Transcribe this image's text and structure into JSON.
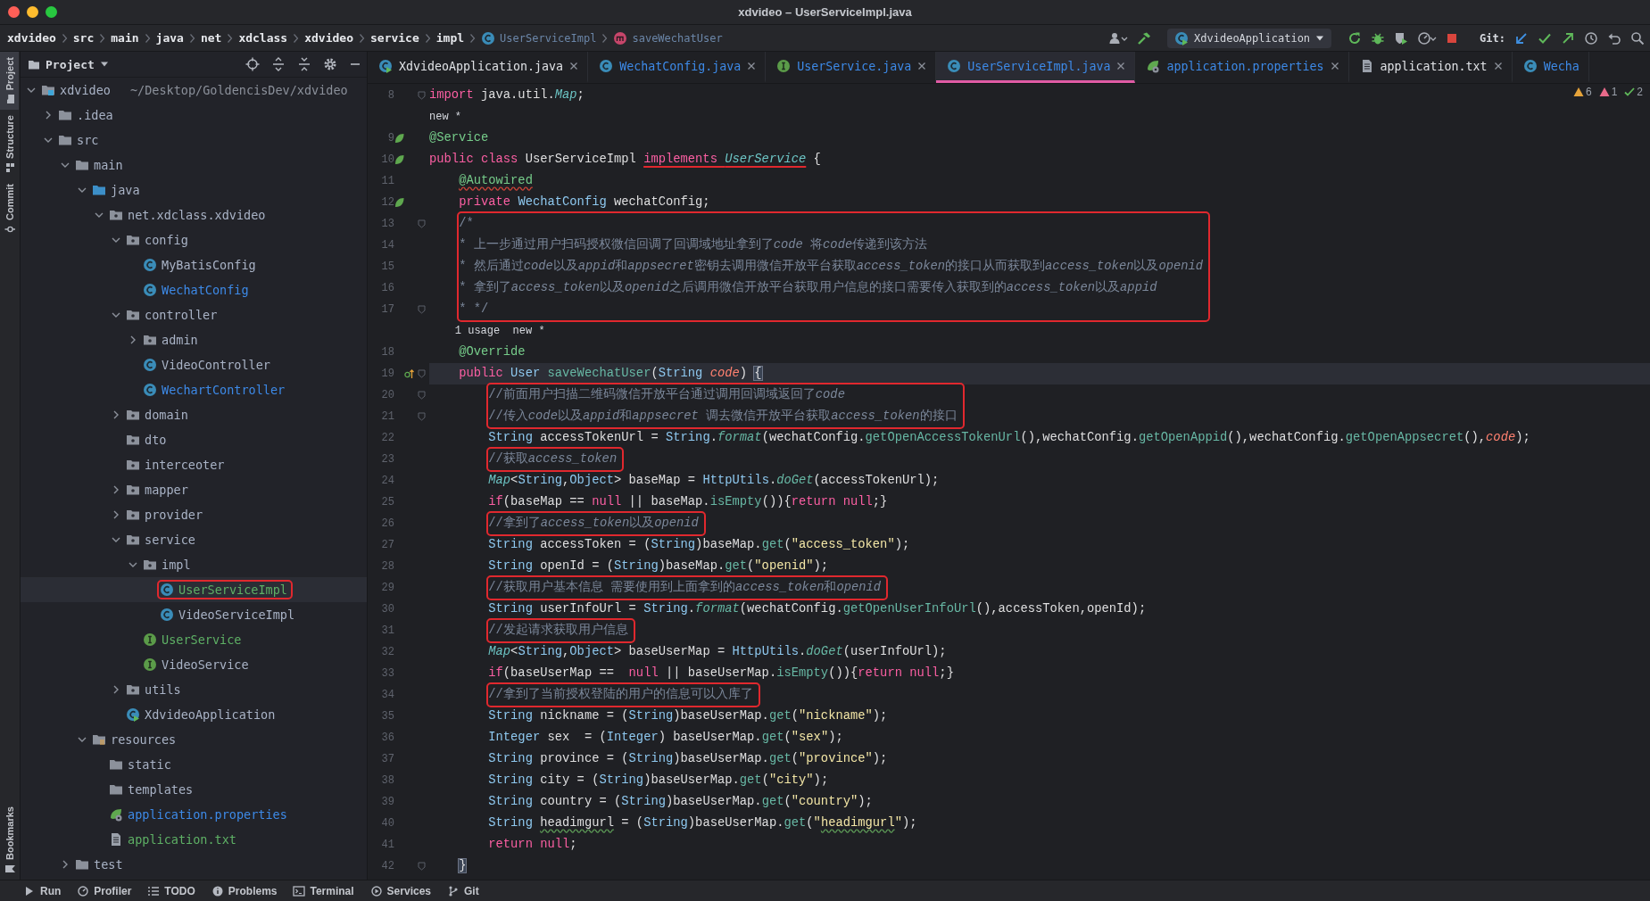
{
  "window": {
    "title": "xdvideo – UserServiceImpl.java"
  },
  "breadcrumb": [
    {
      "text": "xdvideo",
      "kind": "folder"
    },
    {
      "text": "src",
      "kind": "folder"
    },
    {
      "text": "main",
      "kind": "folder"
    },
    {
      "text": "java",
      "kind": "folder"
    },
    {
      "text": "net",
      "kind": "folder"
    },
    {
      "text": "xdclass",
      "kind": "folder"
    },
    {
      "text": "xdvideo",
      "kind": "folder"
    },
    {
      "text": "service",
      "kind": "folder"
    },
    {
      "text": "impl",
      "kind": "folder"
    },
    {
      "text": "UserServiceImpl",
      "kind": "class"
    },
    {
      "text": "saveWechatUser",
      "kind": "method"
    }
  ],
  "toolbar": {
    "run_config": "XdvideoApplication",
    "git_label": "Git:"
  },
  "tool_strip": {
    "top": [
      {
        "label": "Project",
        "kind": "project",
        "selected": true
      },
      {
        "label": "Structure",
        "kind": "structure",
        "selected": false
      },
      {
        "label": "Commit",
        "kind": "commit",
        "selected": false
      }
    ],
    "bottom": [
      {
        "label": "Bookmarks",
        "kind": "bookmarks",
        "selected": false
      }
    ]
  },
  "project_panel": {
    "title": "Project",
    "tree": [
      {
        "label": "xdvideo",
        "path": "~/Desktop/GoldencisDev/xdvideo",
        "kind": "module",
        "color": "#a9b3c6",
        "expanded": true,
        "selected": false,
        "boxed": false,
        "children": [
          {
            "label": ".idea",
            "kind": "folder",
            "color": "#a9b3c6",
            "expanded": false,
            "selected": false,
            "boxed": false
          },
          {
            "label": "src",
            "kind": "folder",
            "color": "#a9b3c6",
            "expanded": true,
            "selected": false,
            "boxed": false,
            "children": [
              {
                "label": "main",
                "kind": "folder",
                "color": "#a9b3c6",
                "expanded": true,
                "selected": false,
                "boxed": false,
                "children": [
                  {
                    "label": "java",
                    "kind": "source-folder",
                    "color": "#a9b3c6",
                    "expanded": true,
                    "selected": false,
                    "boxed": false,
                    "children": [
                      {
                        "label": "net.xdclass.xdvideo",
                        "kind": "package",
                        "color": "#a9b3c6",
                        "expanded": true,
                        "selected": false,
                        "boxed": false,
                        "children": [
                          {
                            "label": "config",
                            "kind": "package",
                            "color": "#a9b3c6",
                            "expanded": true,
                            "selected": false,
                            "boxed": false,
                            "children": [
                              {
                                "label": "MyBatisConfig",
                                "kind": "class",
                                "color": "#a9b3c6",
                                "selected": false,
                                "boxed": false
                              },
                              {
                                "label": "WechatConfig",
                                "kind": "class",
                                "color": "#3d8ae8",
                                "selected": false,
                                "boxed": false
                              }
                            ]
                          },
                          {
                            "label": "controller",
                            "kind": "package",
                            "color": "#a9b3c6",
                            "expanded": true,
                            "selected": false,
                            "boxed": false,
                            "children": [
                              {
                                "label": "admin",
                                "kind": "package",
                                "color": "#a9b3c6",
                                "expanded": false,
                                "selected": false,
                                "boxed": false
                              },
                              {
                                "label": "VideoController",
                                "kind": "class",
                                "color": "#a9b3c6",
                                "selected": false,
                                "boxed": false
                              },
                              {
                                "label": "WechartController",
                                "kind": "class",
                                "color": "#3d8ae8",
                                "selected": false,
                                "boxed": false
                              }
                            ]
                          },
                          {
                            "label": "domain",
                            "kind": "package",
                            "color": "#a9b3c6",
                            "expanded": false,
                            "selected": false,
                            "boxed": false
                          },
                          {
                            "label": "dto",
                            "kind": "package",
                            "color": "#a9b3c6",
                            "selected": false,
                            "boxed": false
                          },
                          {
                            "label": "interceoter",
                            "kind": "package",
                            "color": "#a9b3c6",
                            "selected": false,
                            "boxed": false
                          },
                          {
                            "label": "mapper",
                            "kind": "package",
                            "color": "#a9b3c6",
                            "expanded": false,
                            "selected": false,
                            "boxed": false
                          },
                          {
                            "label": "provider",
                            "kind": "package",
                            "color": "#a9b3c6",
                            "expanded": false,
                            "selected": false,
                            "boxed": false
                          },
                          {
                            "label": "service",
                            "kind": "package",
                            "color": "#a9b3c6",
                            "expanded": true,
                            "selected": false,
                            "boxed": false,
                            "children": [
                              {
                                "label": "impl",
                                "kind": "package",
                                "color": "#a9b3c6",
                                "expanded": true,
                                "selected": false,
                                "boxed": false,
                                "children": [
                                  {
                                    "label": "UserServiceImpl",
                                    "kind": "class",
                                    "color": "#5eb065",
                                    "selected": true,
                                    "boxed": true
                                  },
                                  {
                                    "label": "VideoServiceImpl",
                                    "kind": "class",
                                    "color": "#a9b3c6",
                                    "selected": false,
                                    "boxed": false
                                  }
                                ]
                              },
                              {
                                "label": "UserService",
                                "kind": "interface",
                                "color": "#5eb065",
                                "selected": false,
                                "boxed": false
                              },
                              {
                                "label": "VideoService",
                                "kind": "interface",
                                "color": "#a9b3c6",
                                "selected": false,
                                "boxed": false
                              }
                            ]
                          },
                          {
                            "label": "utils",
                            "kind": "package",
                            "color": "#a9b3c6",
                            "expanded": false,
                            "selected": false,
                            "boxed": false
                          },
                          {
                            "label": "XdvideoApplication",
                            "kind": "app",
                            "color": "#a9b3c6",
                            "selected": false,
                            "boxed": false
                          }
                        ]
                      }
                    ]
                  },
                  {
                    "label": "resources",
                    "kind": "resource-folder",
                    "color": "#a9b3c6",
                    "expanded": true,
                    "selected": false,
                    "boxed": false,
                    "children": [
                      {
                        "label": "static",
                        "kind": "folder",
                        "color": "#a9b3c6",
                        "selected": false,
                        "boxed": false
                      },
                      {
                        "label": "templates",
                        "kind": "folder",
                        "color": "#a9b3c6",
                        "selected": false,
                        "boxed": false
                      },
                      {
                        "label": "application.properties",
                        "kind": "properties",
                        "color": "#3d8ae8",
                        "selected": false,
                        "boxed": false
                      },
                      {
                        "label": "application.txt",
                        "kind": "text",
                        "color": "#5eb065",
                        "selected": false,
                        "boxed": false
                      }
                    ]
                  }
                ]
              },
              {
                "label": "test",
                "kind": "folder",
                "color": "#a9b3c6",
                "expanded": false,
                "selected": false,
                "boxed": false
              }
            ]
          }
        ]
      }
    ]
  },
  "tabs": [
    {
      "label": "XdvideoApplication.java",
      "kind": "app",
      "color": "#dfe1e5",
      "selected": false,
      "closable": true
    },
    {
      "label": "WechatConfig.java",
      "kind": "class",
      "color": "#3d8ae8",
      "selected": false,
      "closable": true
    },
    {
      "label": "UserService.java",
      "kind": "interface",
      "color": "#3d8ae8",
      "selected": false,
      "closable": true
    },
    {
      "label": "UserServiceImpl.java",
      "kind": "class",
      "color": "#3d8ae8",
      "selected": true,
      "closable": true
    },
    {
      "label": "application.properties",
      "kind": "properties",
      "color": "#3d8ae8",
      "selected": false,
      "closable": true
    },
    {
      "label": "application.txt",
      "kind": "text",
      "color": "#dfe1e5",
      "selected": false,
      "closable": true
    },
    {
      "label": "Wecha",
      "kind": "class",
      "color": "#3d8ae8",
      "selected": false,
      "closable": false
    }
  ],
  "inspections": [
    {
      "kind": "warning",
      "count": "6"
    },
    {
      "kind": "weak",
      "count": "1"
    },
    {
      "kind": "ok",
      "count": "2"
    }
  ],
  "editor": {
    "rows": [
      {
        "kind": "code",
        "number": "8",
        "spring_bean": false,
        "overrides": false,
        "fold": true,
        "boxed": false,
        "current": false,
        "tokens": [
          {
            "kind": "keyword",
            "text": "import "
          },
          {
            "kind": "plain",
            "text": "java.util."
          },
          {
            "kind": "type-italic",
            "text": "Map"
          },
          {
            "kind": "plain",
            "text": ";"
          }
        ]
      },
      {
        "kind": "hint",
        "text": "new *"
      },
      {
        "kind": "code",
        "number": "9",
        "spring_bean": true,
        "overrides": false,
        "fold": false,
        "boxed": false,
        "current": false,
        "tokens": [
          {
            "kind": "annotation",
            "text": "@Service"
          }
        ]
      },
      {
        "kind": "code",
        "number": "10",
        "spring_bean": true,
        "overrides": false,
        "fold": false,
        "boxed": false,
        "current": false,
        "tokens": [
          {
            "kind": "keyword",
            "text": "public class "
          },
          {
            "kind": "plain",
            "text": "UserServiceImpl "
          },
          {
            "kind": "keyword",
            "text": "implements ",
            "marked": true
          },
          {
            "kind": "type-italic",
            "text": "UserService",
            "marked": true
          },
          {
            "kind": "plain",
            "text": " {"
          }
        ]
      },
      {
        "kind": "code",
        "number": "11",
        "spring_bean": false,
        "overrides": false,
        "fold": false,
        "boxed": false,
        "current": false,
        "tokens": [
          {
            "kind": "annotation",
            "text": "    @Autowired",
            "error": true
          }
        ]
      },
      {
        "kind": "code",
        "number": "12",
        "spring_bean": true,
        "overrides": false,
        "fold": false,
        "boxed": false,
        "current": false,
        "tokens": [
          {
            "kind": "keyword",
            "text": "    private "
          },
          {
            "kind": "type",
            "text": "WechatConfig "
          },
          {
            "kind": "plain",
            "text": "wechatConfig;"
          }
        ]
      },
      {
        "kind": "code",
        "number": "13",
        "spring_bean": false,
        "overrides": false,
        "fold": true,
        "boxed": true,
        "current": false,
        "tokens": [
          {
            "kind": "comment",
            "text": "    /*"
          }
        ]
      },
      {
        "kind": "code",
        "number": "14",
        "spring_bean": false,
        "overrides": false,
        "fold": false,
        "boxed": true,
        "current": false,
        "tokens": [
          {
            "kind": "comment",
            "text": "    * 上一步通过用户扫码授权微信回调了回调域地址拿到了"
          },
          {
            "kind": "comment-italic",
            "text": "code"
          },
          {
            "kind": "comment",
            "text": " 将"
          },
          {
            "kind": "comment-italic",
            "text": "code"
          },
          {
            "kind": "comment",
            "text": "传递到该方法"
          }
        ]
      },
      {
        "kind": "code",
        "number": "15",
        "spring_bean": false,
        "overrides": false,
        "fold": false,
        "boxed": true,
        "current": false,
        "tokens": [
          {
            "kind": "comment",
            "text": "    * 然后通过"
          },
          {
            "kind": "comment-italic",
            "text": "code"
          },
          {
            "kind": "comment",
            "text": "以及"
          },
          {
            "kind": "comment-italic",
            "text": "appid"
          },
          {
            "kind": "comment",
            "text": "和"
          },
          {
            "kind": "comment-italic",
            "text": "appsecret"
          },
          {
            "kind": "comment",
            "text": "密钥去调用微信开放平台获取"
          },
          {
            "kind": "comment-italic",
            "text": "access_token"
          },
          {
            "kind": "comment",
            "text": "的接口从而获取到"
          },
          {
            "kind": "comment-italic",
            "text": "access_token"
          },
          {
            "kind": "comment",
            "text": "以及"
          },
          {
            "kind": "comment-italic",
            "text": "openid"
          }
        ]
      },
      {
        "kind": "code",
        "number": "16",
        "spring_bean": false,
        "overrides": false,
        "fold": false,
        "boxed": true,
        "current": false,
        "tokens": [
          {
            "kind": "comment",
            "text": "    * 拿到了"
          },
          {
            "kind": "comment-italic",
            "text": "access_token"
          },
          {
            "kind": "comment",
            "text": "以及"
          },
          {
            "kind": "comment-italic",
            "text": "openid"
          },
          {
            "kind": "comment",
            "text": "之后调用微信开放平台获取用户信息的接口需要传入获取到的"
          },
          {
            "kind": "comment-italic",
            "text": "access_token"
          },
          {
            "kind": "comment",
            "text": "以及"
          },
          {
            "kind": "comment-italic",
            "text": "appid"
          }
        ]
      },
      {
        "kind": "code",
        "number": "17",
        "spring_bean": false,
        "overrides": false,
        "fold": true,
        "boxed": true,
        "current": false,
        "tokens": [
          {
            "kind": "comment",
            "text": "    * */"
          }
        ]
      },
      {
        "kind": "hint",
        "text": "    1 usage  new *"
      },
      {
        "kind": "code",
        "number": "18",
        "spring_bean": false,
        "overrides": false,
        "fold": false,
        "boxed": false,
        "current": false,
        "tokens": [
          {
            "kind": "annotation",
            "text": "    @Override"
          }
        ]
      },
      {
        "kind": "code",
        "number": "19",
        "spring_bean": false,
        "overrides": true,
        "fold": true,
        "boxed": false,
        "current": true,
        "tokens": [
          {
            "kind": "keyword",
            "text": "    public "
          },
          {
            "kind": "type",
            "text": "User "
          },
          {
            "kind": "method",
            "text": "saveWechatUser"
          },
          {
            "kind": "plain",
            "text": "("
          },
          {
            "kind": "type",
            "text": "String "
          },
          {
            "kind": "parameter",
            "text": "code"
          },
          {
            "kind": "plain",
            "text": ") "
          },
          {
            "kind": "plain",
            "text": "{",
            "matched": true
          }
        ]
      },
      {
        "kind": "code",
        "number": "20",
        "spring_bean": false,
        "overrides": false,
        "fold": true,
        "boxed": true,
        "current": false,
        "tokens": [
          {
            "kind": "comment",
            "text": "        //前面用户扫描二维码微信开放平台通过调用回调域返回了"
          },
          {
            "kind": "comment-italic",
            "text": "code"
          }
        ]
      },
      {
        "kind": "code",
        "number": "21",
        "spring_bean": false,
        "overrides": false,
        "fold": true,
        "boxed": true,
        "current": false,
        "tokens": [
          {
            "kind": "comment",
            "text": "        //传入"
          },
          {
            "kind": "comment-italic",
            "text": "code"
          },
          {
            "kind": "comment",
            "text": "以及"
          },
          {
            "kind": "comment-italic",
            "text": "appid"
          },
          {
            "kind": "comment",
            "text": "和"
          },
          {
            "kind": "comment-italic",
            "text": "appsecret"
          },
          {
            "kind": "comment",
            "text": " 调去微信开放平台获取"
          },
          {
            "kind": "comment-italic",
            "text": "access_token"
          },
          {
            "kind": "comment",
            "text": "的接口"
          }
        ]
      },
      {
        "kind": "code",
        "number": "22",
        "spring_bean": false,
        "overrides": false,
        "fold": false,
        "boxed": false,
        "current": false,
        "tokens": [
          {
            "kind": "type",
            "text": "        String "
          },
          {
            "kind": "plain",
            "text": "accessTokenUrl = "
          },
          {
            "kind": "type",
            "text": "String"
          },
          {
            "kind": "plain",
            "text": "."
          },
          {
            "kind": "static-method",
            "text": "format"
          },
          {
            "kind": "plain",
            "text": "(wechatConfig."
          },
          {
            "kind": "method",
            "text": "getOpenAccessTokenUrl"
          },
          {
            "kind": "plain",
            "text": "(),wechatConfig."
          },
          {
            "kind": "method",
            "text": "getOpenAppid"
          },
          {
            "kind": "plain",
            "text": "(),wechatConfig."
          },
          {
            "kind": "method",
            "text": "getOpenAppsecret"
          },
          {
            "kind": "plain",
            "text": "(),"
          },
          {
            "kind": "parameter",
            "text": "code"
          },
          {
            "kind": "plain",
            "text": ");"
          }
        ]
      },
      {
        "kind": "code",
        "number": "23",
        "spring_bean": false,
        "overrides": false,
        "fold": false,
        "boxed": true,
        "current": false,
        "tokens": [
          {
            "kind": "comment",
            "text": "        //获取"
          },
          {
            "kind": "comment-italic",
            "text": "access_token"
          }
        ]
      },
      {
        "kind": "code",
        "number": "24",
        "spring_bean": false,
        "overrides": false,
        "fold": false,
        "boxed": false,
        "current": false,
        "tokens": [
          {
            "kind": "type-italic",
            "text": "        Map"
          },
          {
            "kind": "plain",
            "text": "<"
          },
          {
            "kind": "type",
            "text": "String"
          },
          {
            "kind": "plain",
            "text": ","
          },
          {
            "kind": "type",
            "text": "Object"
          },
          {
            "kind": "plain",
            "text": "> baseMap = "
          },
          {
            "kind": "type",
            "text": "HttpUtils"
          },
          {
            "kind": "plain",
            "text": "."
          },
          {
            "kind": "static-method",
            "text": "doGet"
          },
          {
            "kind": "plain",
            "text": "(accessTokenUrl);"
          }
        ]
      },
      {
        "kind": "code",
        "number": "25",
        "spring_bean": false,
        "overrides": false,
        "fold": false,
        "boxed": false,
        "current": false,
        "tokens": [
          {
            "kind": "keyword",
            "text": "        if"
          },
          {
            "kind": "plain",
            "text": "(baseMap == "
          },
          {
            "kind": "keyword",
            "text": "null"
          },
          {
            "kind": "plain",
            "text": " || baseMap."
          },
          {
            "kind": "method",
            "text": "isEmpty"
          },
          {
            "kind": "plain",
            "text": "()){"
          },
          {
            "kind": "keyword",
            "text": "return null"
          },
          {
            "kind": "plain",
            "text": ";}"
          }
        ]
      },
      {
        "kind": "code",
        "number": "26",
        "spring_bean": false,
        "overrides": false,
        "fold": false,
        "boxed": true,
        "current": false,
        "tokens": [
          {
            "kind": "comment",
            "text": "        //拿到了"
          },
          {
            "kind": "comment-italic",
            "text": "access_token"
          },
          {
            "kind": "comment",
            "text": "以及"
          },
          {
            "kind": "comment-italic",
            "text": "openid"
          }
        ]
      },
      {
        "kind": "code",
        "number": "27",
        "spring_bean": false,
        "overrides": false,
        "fold": false,
        "boxed": false,
        "current": false,
        "tokens": [
          {
            "kind": "type",
            "text": "        String "
          },
          {
            "kind": "plain",
            "text": "accessToken = ("
          },
          {
            "kind": "type",
            "text": "String"
          },
          {
            "kind": "plain",
            "text": ")baseMap."
          },
          {
            "kind": "method",
            "text": "get"
          },
          {
            "kind": "plain",
            "text": "("
          },
          {
            "kind": "string",
            "text": "\"access_token\""
          },
          {
            "kind": "plain",
            "text": ");"
          }
        ]
      },
      {
        "kind": "code",
        "number": "28",
        "spring_bean": false,
        "overrides": false,
        "fold": false,
        "boxed": false,
        "current": false,
        "tokens": [
          {
            "kind": "type",
            "text": "        String "
          },
          {
            "kind": "plain",
            "text": "openId = ("
          },
          {
            "kind": "type",
            "text": "String"
          },
          {
            "kind": "plain",
            "text": ")baseMap."
          },
          {
            "kind": "method",
            "text": "get"
          },
          {
            "kind": "plain",
            "text": "("
          },
          {
            "kind": "string",
            "text": "\"openid\""
          },
          {
            "kind": "plain",
            "text": ");"
          }
        ]
      },
      {
        "kind": "code",
        "number": "29",
        "spring_bean": false,
        "overrides": false,
        "fold": false,
        "boxed": true,
        "current": false,
        "tokens": [
          {
            "kind": "comment",
            "text": "        //获取用户基本信息 需要使用到上面拿到的"
          },
          {
            "kind": "comment-italic",
            "text": "access_token"
          },
          {
            "kind": "comment",
            "text": "和"
          },
          {
            "kind": "comment-italic",
            "text": "openid"
          }
        ]
      },
      {
        "kind": "code",
        "number": "30",
        "spring_bean": false,
        "overrides": false,
        "fold": false,
        "boxed": false,
        "current": false,
        "tokens": [
          {
            "kind": "type",
            "text": "        String "
          },
          {
            "kind": "plain",
            "text": "userInfoUrl = "
          },
          {
            "kind": "type",
            "text": "String"
          },
          {
            "kind": "plain",
            "text": "."
          },
          {
            "kind": "static-method",
            "text": "format"
          },
          {
            "kind": "plain",
            "text": "(wechatConfig."
          },
          {
            "kind": "method",
            "text": "getOpenUserInfoUrl"
          },
          {
            "kind": "plain",
            "text": "(),accessToken,openId);"
          }
        ]
      },
      {
        "kind": "code",
        "number": "31",
        "spring_bean": false,
        "overrides": false,
        "fold": false,
        "boxed": true,
        "current": false,
        "tokens": [
          {
            "kind": "comment",
            "text": "        //发起请求获取用户信息"
          }
        ]
      },
      {
        "kind": "code",
        "number": "32",
        "spring_bean": false,
        "overrides": false,
        "fold": false,
        "boxed": false,
        "current": false,
        "tokens": [
          {
            "kind": "type-italic",
            "text": "        Map"
          },
          {
            "kind": "plain",
            "text": "<"
          },
          {
            "kind": "type",
            "text": "String"
          },
          {
            "kind": "plain",
            "text": ","
          },
          {
            "kind": "type",
            "text": "Object"
          },
          {
            "kind": "plain",
            "text": "> baseUserMap = "
          },
          {
            "kind": "type",
            "text": "HttpUtils"
          },
          {
            "kind": "plain",
            "text": "."
          },
          {
            "kind": "static-method",
            "text": "doGet"
          },
          {
            "kind": "plain",
            "text": "(userInfoUrl);"
          }
        ]
      },
      {
        "kind": "code",
        "number": "33",
        "spring_bean": false,
        "overrides": false,
        "fold": false,
        "boxed": false,
        "current": false,
        "tokens": [
          {
            "kind": "keyword",
            "text": "        if"
          },
          {
            "kind": "plain",
            "text": "(baseUserMap ==  "
          },
          {
            "kind": "keyword",
            "text": "null"
          },
          {
            "kind": "plain",
            "text": " || baseUserMap."
          },
          {
            "kind": "method",
            "text": "isEmpty"
          },
          {
            "kind": "plain",
            "text": "()){"
          },
          {
            "kind": "keyword",
            "text": "return null"
          },
          {
            "kind": "plain",
            "text": ";}"
          }
        ]
      },
      {
        "kind": "code",
        "number": "34",
        "spring_bean": false,
        "overrides": false,
        "fold": false,
        "boxed": true,
        "current": false,
        "tokens": [
          {
            "kind": "comment",
            "text": "        //拿到了当前授权登陆的用户的信息可以入库了"
          }
        ]
      },
      {
        "kind": "code",
        "number": "35",
        "spring_bean": false,
        "overrides": false,
        "fold": false,
        "boxed": false,
        "current": false,
        "tokens": [
          {
            "kind": "type",
            "text": "        String "
          },
          {
            "kind": "plain",
            "text": "nickname = ("
          },
          {
            "kind": "type",
            "text": "String"
          },
          {
            "kind": "plain",
            "text": ")baseUserMap."
          },
          {
            "kind": "method",
            "text": "get"
          },
          {
            "kind": "plain",
            "text": "("
          },
          {
            "kind": "string",
            "text": "\"nickname\""
          },
          {
            "kind": "plain",
            "text": ");"
          }
        ]
      },
      {
        "kind": "code",
        "number": "36",
        "spring_bean": false,
        "overrides": false,
        "fold": false,
        "boxed": false,
        "current": false,
        "tokens": [
          {
            "kind": "type",
            "text": "        Integer "
          },
          {
            "kind": "plain",
            "text": "sex  = ("
          },
          {
            "kind": "type",
            "text": "Integer"
          },
          {
            "kind": "plain",
            "text": ") baseUserMap."
          },
          {
            "kind": "method",
            "text": "get"
          },
          {
            "kind": "plain",
            "text": "("
          },
          {
            "kind": "string",
            "text": "\"sex\""
          },
          {
            "kind": "plain",
            "text": ");"
          }
        ]
      },
      {
        "kind": "code",
        "number": "37",
        "spring_bean": false,
        "overrides": false,
        "fold": false,
        "boxed": false,
        "current": false,
        "tokens": [
          {
            "kind": "type",
            "text": "        String "
          },
          {
            "kind": "plain",
            "text": "province = ("
          },
          {
            "kind": "type",
            "text": "String"
          },
          {
            "kind": "plain",
            "text": ")baseUserMap."
          },
          {
            "kind": "method",
            "text": "get"
          },
          {
            "kind": "plain",
            "text": "("
          },
          {
            "kind": "string",
            "text": "\"province\""
          },
          {
            "kind": "plain",
            "text": ");"
          }
        ]
      },
      {
        "kind": "code",
        "number": "38",
        "spring_bean": false,
        "overrides": false,
        "fold": false,
        "boxed": false,
        "current": false,
        "tokens": [
          {
            "kind": "type",
            "text": "        String "
          },
          {
            "kind": "plain",
            "text": "city = ("
          },
          {
            "kind": "type",
            "text": "String"
          },
          {
            "kind": "plain",
            "text": ")baseUserMap."
          },
          {
            "kind": "method",
            "text": "get"
          },
          {
            "kind": "plain",
            "text": "("
          },
          {
            "kind": "string",
            "text": "\"city\""
          },
          {
            "kind": "plain",
            "text": ");"
          }
        ]
      },
      {
        "kind": "code",
        "number": "39",
        "spring_bean": false,
        "overrides": false,
        "fold": false,
        "boxed": false,
        "current": false,
        "tokens": [
          {
            "kind": "type",
            "text": "        String "
          },
          {
            "kind": "plain",
            "text": "country = ("
          },
          {
            "kind": "type",
            "text": "String"
          },
          {
            "kind": "plain",
            "text": ")baseUserMap."
          },
          {
            "kind": "method",
            "text": "get"
          },
          {
            "kind": "plain",
            "text": "("
          },
          {
            "kind": "string",
            "text": "\"country\""
          },
          {
            "kind": "plain",
            "text": ");"
          }
        ]
      },
      {
        "kind": "code",
        "number": "40",
        "spring_bean": false,
        "overrides": false,
        "fold": false,
        "boxed": false,
        "current": false,
        "tokens": [
          {
            "kind": "type",
            "text": "        String "
          },
          {
            "kind": "plain",
            "text": "headimgurl",
            "typo": true
          },
          {
            "kind": "plain",
            "text": " = ("
          },
          {
            "kind": "type",
            "text": "String"
          },
          {
            "kind": "plain",
            "text": ")baseUserMap."
          },
          {
            "kind": "method",
            "text": "get"
          },
          {
            "kind": "plain",
            "text": "("
          },
          {
            "kind": "string",
            "text": "\""
          },
          {
            "kind": "string",
            "text": "headimgurl",
            "typo": true
          },
          {
            "kind": "string",
            "text": "\""
          },
          {
            "kind": "plain",
            "text": ");"
          }
        ]
      },
      {
        "kind": "code",
        "number": "41",
        "spring_bean": false,
        "overrides": false,
        "fold": false,
        "boxed": false,
        "current": false,
        "tokens": [
          {
            "kind": "keyword",
            "text": "        return null"
          },
          {
            "kind": "plain",
            "text": ";"
          }
        ]
      },
      {
        "kind": "code",
        "number": "42",
        "spring_bean": false,
        "overrides": false,
        "fold": true,
        "boxed": false,
        "current": false,
        "tokens": [
          {
            "kind": "plain",
            "text": "    }",
            "matched": true
          }
        ]
      }
    ]
  },
  "bottom_bar": [
    {
      "label": "Run"
    },
    {
      "label": "Profiler"
    },
    {
      "label": "TODO"
    },
    {
      "label": "Problems"
    },
    {
      "label": "Terminal"
    },
    {
      "label": "Services"
    },
    {
      "label": "Git"
    }
  ]
}
